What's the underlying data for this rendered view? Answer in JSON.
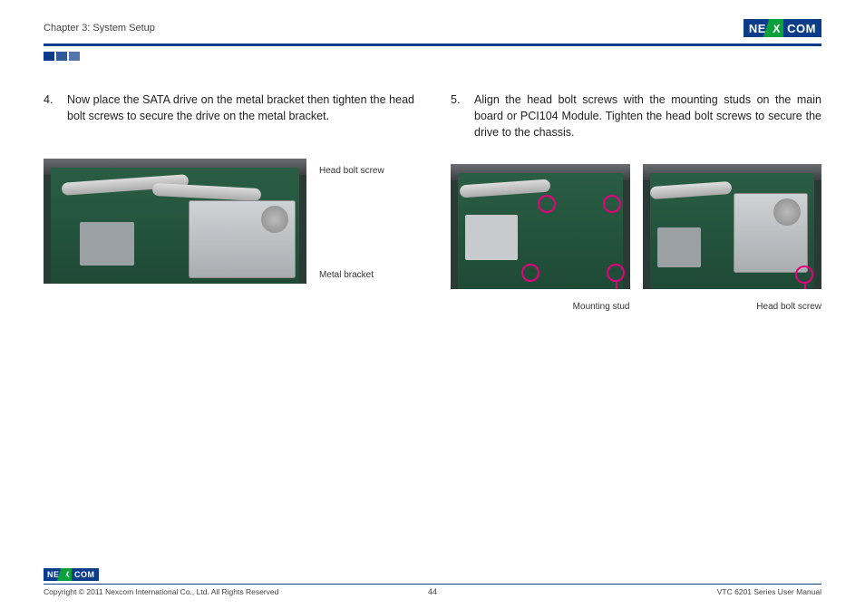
{
  "header": {
    "chapter": "Chapter 3: System Setup"
  },
  "logo": {
    "left": "NE",
    "mid": "X",
    "right": "COM"
  },
  "left": {
    "step_num": "4.",
    "step_text": "Now place the SATA drive on the metal bracket then tighten the head bolt screws to secure the drive on the metal bracket.",
    "label_top": "Head bolt screw",
    "label_bottom": "Metal bracket"
  },
  "right": {
    "step_num": "5.",
    "step_text": "Align the head bolt screws with the mounting studs on the main board or PCI104 Module. Tighten the head bolt screws to secure the drive to the chassis.",
    "caption_a": "Mounting stud",
    "caption_b": "Head bolt screw"
  },
  "footer": {
    "copyright": "Copyright © 2011 Nexcom International Co., Ltd. All Rights Reserved",
    "page": "44",
    "manual": "VTC 6201 Series User Manual"
  }
}
